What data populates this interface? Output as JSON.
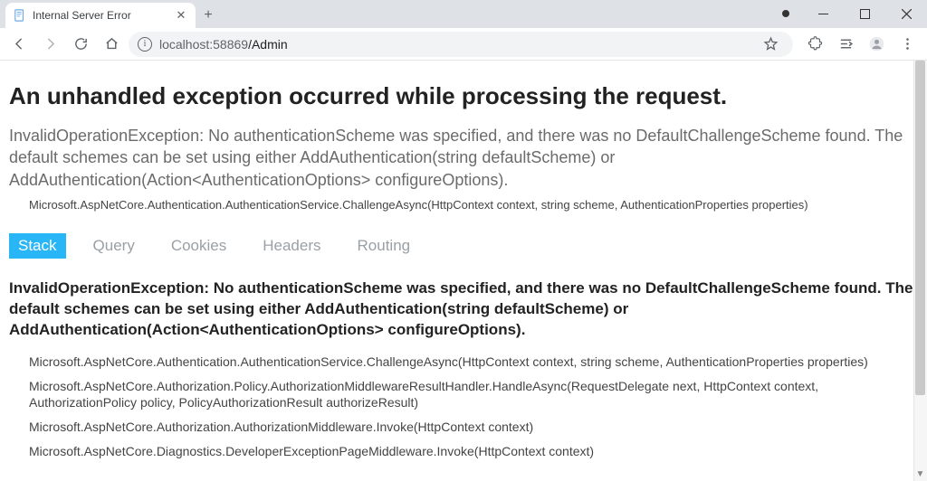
{
  "window": {
    "tab_title": "Internal Server Error"
  },
  "toolbar": {
    "url_host": "localhost:58869",
    "url_path": "/Admin"
  },
  "page": {
    "heading": "An unhandled exception occurred while processing the request.",
    "summary": "InvalidOperationException: No authenticationScheme was specified, and there was no DefaultChallengeScheme found. The default schemes can be set using either AddAuthentication(string defaultScheme) or AddAuthentication(Action<AuthenticationOptions> configureOptions).",
    "origin": "Microsoft.AspNetCore.Authentication.AuthenticationService.ChallengeAsync(HttpContext context, string scheme, AuthenticationProperties properties)",
    "tabs": {
      "stack": "Stack",
      "query": "Query",
      "cookies": "Cookies",
      "headers": "Headers",
      "routing": "Routing"
    },
    "stack_header": "InvalidOperationException: No authenticationScheme was specified, and there was no DefaultChallengeScheme found. The default schemes can be set using either AddAuthentication(string defaultScheme) or AddAuthentication(Action<AuthenticationOptions> configureOptions).",
    "stack_lines": [
      "Microsoft.AspNetCore.Authentication.AuthenticationService.ChallengeAsync(HttpContext context, string scheme, AuthenticationProperties properties)",
      "Microsoft.AspNetCore.Authorization.Policy.AuthorizationMiddlewareResultHandler.HandleAsync(RequestDelegate next, HttpContext context, AuthorizationPolicy policy, PolicyAuthorizationResult authorizeResult)",
      "Microsoft.AspNetCore.Authorization.AuthorizationMiddleware.Invoke(HttpContext context)",
      "Microsoft.AspNetCore.Diagnostics.DeveloperExceptionPageMiddleware.Invoke(HttpContext context)"
    ]
  }
}
